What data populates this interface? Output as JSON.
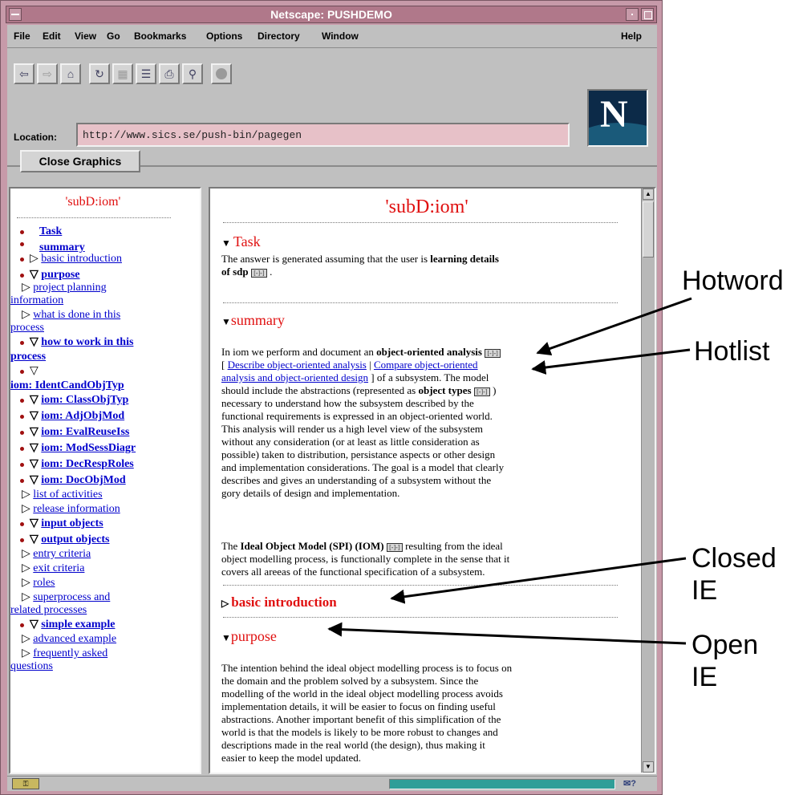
{
  "window": {
    "title": "Netscape: PUSHDEMO"
  },
  "menu": [
    "File",
    "Edit",
    "View",
    "Go",
    "Bookmarks",
    "Options",
    "Directory",
    "Window"
  ],
  "menu_help": "Help",
  "toolbar": {
    "location_label": "Location:",
    "location_value": "http://www.sics.se/push-bin/pagegen",
    "logo_letter": "N"
  },
  "close_graphics": "Close Graphics",
  "left": {
    "title": "'subD:iom'",
    "items": [
      {
        "label": "Task"
      },
      {
        "label": "summary"
      },
      {
        "label": "basic introduction"
      },
      {
        "label": "purpose"
      },
      {
        "label": "project planning"
      },
      {
        "label": "information"
      },
      {
        "label": "what is done in this"
      },
      {
        "label": "process"
      },
      {
        "label": "how to work in this"
      },
      {
        "label": "process"
      },
      {
        "label": "iom: IdentCandObjTyp"
      },
      {
        "label": "iom: ClassObjTyp"
      },
      {
        "label": "iom: AdjObjMod"
      },
      {
        "label": "iom: EvalReuseIss"
      },
      {
        "label": "iom: ModSessDiagr"
      },
      {
        "label": "iom: DecRespRoles"
      },
      {
        "label": "iom: DocObjMod"
      },
      {
        "label": "list of activities"
      },
      {
        "label": "release information"
      },
      {
        "label": "input objects"
      },
      {
        "label": "output objects"
      },
      {
        "label": "entry criteria"
      },
      {
        "label": "exit criteria"
      },
      {
        "label": "roles"
      },
      {
        "label": "superprocess and"
      },
      {
        "label": "related processes"
      },
      {
        "label": "simple example"
      },
      {
        "label": "advanced example"
      },
      {
        "label": "frequently asked"
      },
      {
        "label": "questions"
      }
    ]
  },
  "main": {
    "title": "'subD:iom'",
    "task_heading": "Task",
    "task_text_1": "The answer is generated assuming that the user is",
    "task_bold": "learning details",
    "task_text_2": "of sdp",
    "summary_heading": "summary",
    "summary_intro": "In iom we perform and document an",
    "summary_bold": "object-oriented analysis",
    "link_1": "Describe object-oriented analysis",
    "link_sep": "|",
    "link_2a": "Compare object-oriented",
    "link_2b": "analysis and object-oriented design",
    "summary_after_link": "] of a subsystem. The model",
    "summary_lines": [
      "should include the abstractions (represented as",
      "necessary to understand how the subsystem described by the",
      "functional requirements is expressed in an object-oriented world.",
      "This analysis will render us a high level view of the subsystem",
      "without any consideration (or at least as little consideration as",
      "possible) taken to distribution, persistance aspects or other design",
      "and implementation considerations. The goal is a model that clearly",
      "describes and gives an understanding of a subsystem without the",
      "gory details of design and implementation."
    ],
    "object_types": "object types",
    "ideal_prefix": "The",
    "ideal_bold": "Ideal Object Model (SPI) (IOM)",
    "ideal_suffix": "resulting from the ideal",
    "ideal_lines": [
      "object modelling process, is functionally complete in the sense that it",
      "covers all areeas of the functional specification of a subsystem."
    ],
    "basic_heading": "basic introduction",
    "purpose_heading": "purpose",
    "purpose_lines": [
      "The intention behind the ideal object modelling process is to focus on",
      "the domain and the problem solved by a subsystem. Since the",
      "modelling of the world in the ideal object modelling process avoids",
      "implementation details, it will be easier to focus on finding useful",
      "abstractions. Another important benefit of this simplification of the",
      "world is that the models is likely to be more robust to changes and",
      "descriptions made in the real world (the design), thus making it",
      "easier to keep the model updated."
    ],
    "box_label": "[-]-]"
  },
  "status": {
    "mail": "✉?"
  },
  "annotations": {
    "hotword": "Hotword",
    "hotlist": "Hotlist",
    "closed": "Closed",
    "closed_2": "IE",
    "open": "Open",
    "open_2": "IE"
  }
}
